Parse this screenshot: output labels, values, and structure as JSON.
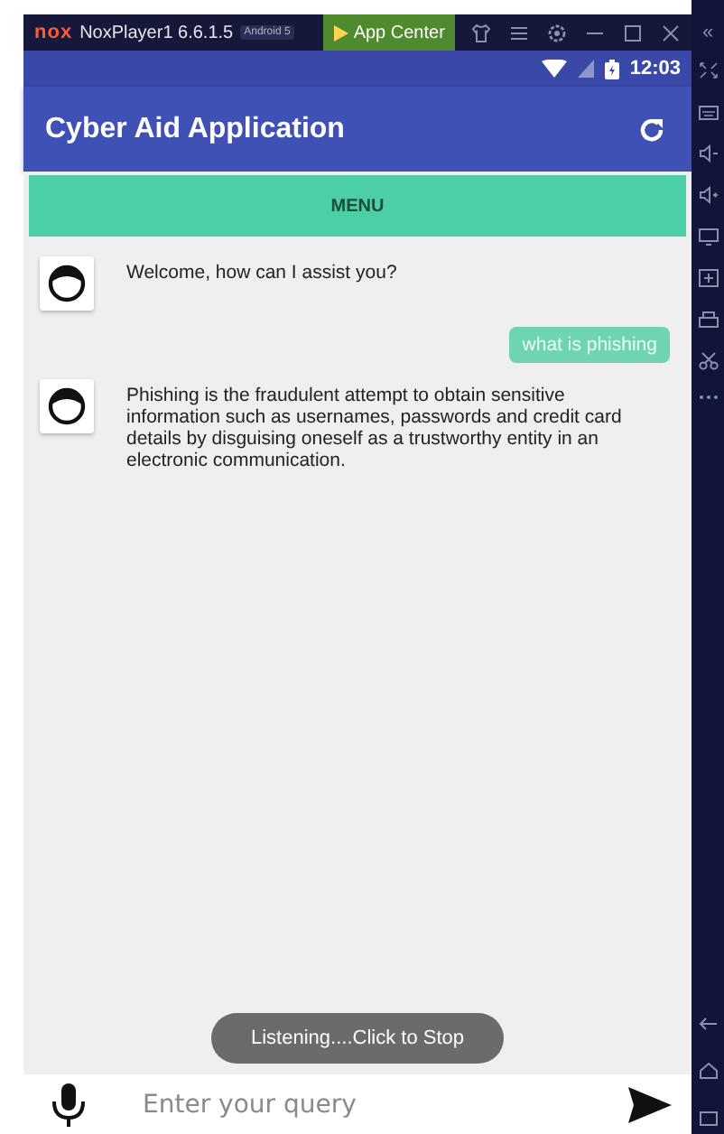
{
  "titlebar": {
    "logo": "nox",
    "title": "NoxPlayer1 6.6.1.5",
    "badge": "Android 5",
    "app_center": "App Center",
    "collapse": "«"
  },
  "status_bar": {
    "time": "12:03"
  },
  "app_bar": {
    "title": "Cyber Aid Application"
  },
  "menu_button": "MENU",
  "messages": [
    {
      "kind": "bot",
      "text": "Welcome, how can I assist you?"
    },
    {
      "kind": "user",
      "text": "what is phishing"
    },
    {
      "kind": "bot",
      "text": "Phishing is the fraudulent attempt to obtain sensitive information such as usernames, passwords and credit card details by disguising oneself as a trustworthy entity in an electronic communication."
    }
  ],
  "toast": "Listening....Click to Stop",
  "input": {
    "placeholder": "Enter your query"
  }
}
